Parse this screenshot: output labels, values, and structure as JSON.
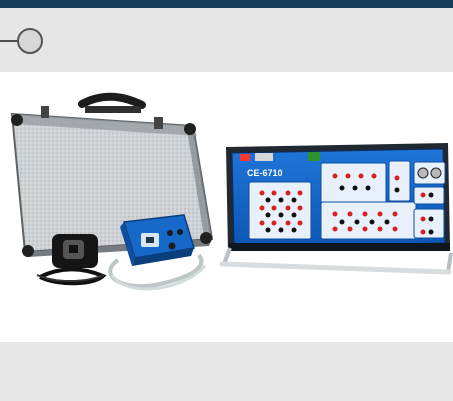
{
  "product": {
    "model": "CE-6710"
  }
}
